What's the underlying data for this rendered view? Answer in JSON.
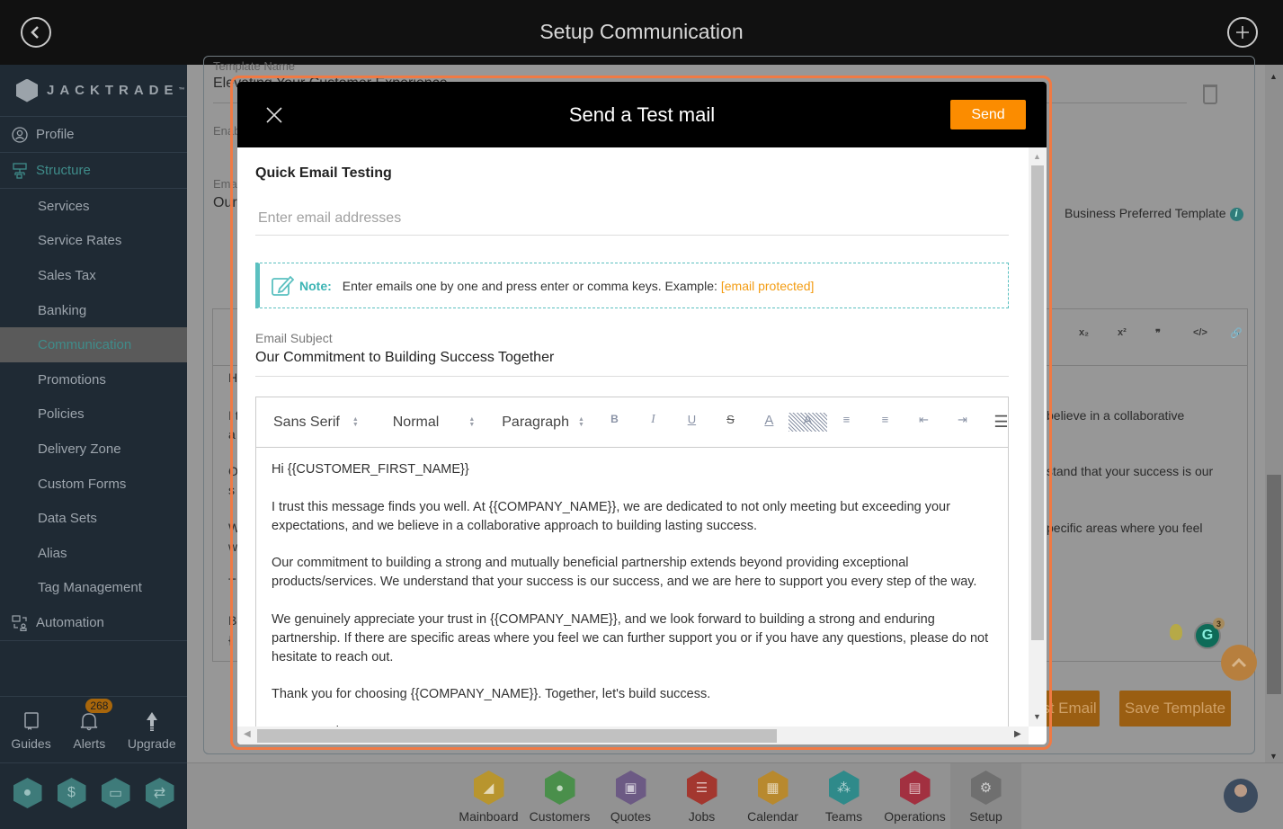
{
  "header": {
    "title": "Setup Communication",
    "back_icon": "back-arrow-icon",
    "add_icon": "plus-circle-icon"
  },
  "sidebar": {
    "logo_text": "JACKTRADE",
    "logo_tm": "™",
    "items": [
      {
        "label": "Profile",
        "type": "top",
        "icon": "user-circle-icon"
      },
      {
        "label": "Structure",
        "type": "section",
        "icon": "sitemap-icon"
      },
      {
        "label": "Services",
        "type": "sub"
      },
      {
        "label": "Service Rates",
        "type": "sub"
      },
      {
        "label": "Sales Tax",
        "type": "sub"
      },
      {
        "label": "Banking",
        "type": "sub"
      },
      {
        "label": "Communication",
        "type": "sub",
        "active": true
      },
      {
        "label": "Promotions",
        "type": "sub"
      },
      {
        "label": "Policies",
        "type": "sub"
      },
      {
        "label": "Delivery Zone",
        "type": "sub"
      },
      {
        "label": "Custom Forms",
        "type": "sub"
      },
      {
        "label": "Data Sets",
        "type": "sub"
      },
      {
        "label": "Alias",
        "type": "sub"
      },
      {
        "label": "Tag Management",
        "type": "sub"
      },
      {
        "label": "Automation",
        "type": "top",
        "icon": "automation-icon"
      }
    ],
    "tools": [
      {
        "label": "Guides",
        "icon": "book-icon"
      },
      {
        "label": "Alerts",
        "icon": "bell-icon",
        "badge": "268"
      },
      {
        "label": "Upgrade",
        "icon": "arrow-up-icon"
      }
    ],
    "quick_icons": [
      "user-hex-icon",
      "dollar-hex-icon",
      "money-hex-icon",
      "workflow-hex-icon"
    ]
  },
  "background": {
    "template_name_label": "Template Name",
    "template_name_value": "Elevating Your Customer Experience",
    "enable_label": "Enab",
    "email_label": "Ema",
    "email_value": "Our",
    "business_preferred": "Business Preferred Template",
    "toolbar_fragments": [
      "¶",
      "x₂",
      "x²",
      "❞",
      "</>",
      "🔗"
    ],
    "body_fragments": [
      {
        "left": "H",
        "right": ""
      },
      {
        "left": "I t",
        "right": "believe in a collaborative"
      },
      {
        "left": "a",
        "right": ""
      },
      {
        "left": "O",
        "right": "stand that your success is our"
      },
      {
        "left": "s",
        "right": ""
      },
      {
        "left": "W",
        "right": "pecific areas where you feel"
      },
      {
        "left": "w",
        "right": ""
      },
      {
        "left": "T",
        "right": ""
      },
      {
        "left": "B",
        "right": ""
      },
      {
        "left": "{",
        "right": ""
      }
    ],
    "test_email_button": "Test Email",
    "save_template_button": "Save Template",
    "grammarly_count": "3"
  },
  "dock": {
    "items": [
      {
        "label": "Mainboard",
        "color": "#b8952e",
        "icon": "mainboard-icon"
      },
      {
        "label": "Customers",
        "color": "#4a8f4b",
        "icon": "customers-icon"
      },
      {
        "label": "Quotes",
        "color": "#6c5a84",
        "icon": "quotes-icon"
      },
      {
        "label": "Jobs",
        "color": "#a3372f",
        "icon": "jobs-icon"
      },
      {
        "label": "Calendar",
        "color": "#b8892e",
        "icon": "calendar-icon"
      },
      {
        "label": "Teams",
        "color": "#2f8a8a",
        "icon": "teams-icon"
      },
      {
        "label": "Operations",
        "color": "#a23040",
        "icon": "operations-icon"
      },
      {
        "label": "Setup",
        "color": "#6f6f6f",
        "icon": "gear-icon",
        "active": true
      }
    ]
  },
  "modal": {
    "title": "Send a Test mail",
    "send_label": "Send",
    "section_title": "Quick Email Testing",
    "email_placeholder": "Enter email addresses",
    "email_value": "",
    "note_label": "Note:",
    "note_text": "Enter emails one by one and press enter or comma keys. Example:",
    "note_example": "[email protected]",
    "subject_label": "Email Subject",
    "subject_value": "Our Commitment to Building Success Together",
    "editor": {
      "font": "Sans Serif",
      "size": "Normal",
      "block": "Paragraph",
      "buttons": [
        {
          "name": "bold-button",
          "glyph": "B"
        },
        {
          "name": "italic-button",
          "glyph": "I"
        },
        {
          "name": "underline-button",
          "glyph": "U"
        },
        {
          "name": "strike-button",
          "glyph": "S"
        },
        {
          "name": "text-color-button",
          "glyph": "A"
        },
        {
          "name": "highlight-button",
          "glyph": "A"
        },
        {
          "name": "ordered-list-button",
          "glyph": "≡"
        },
        {
          "name": "bullet-list-button",
          "glyph": "≡"
        },
        {
          "name": "outdent-button",
          "glyph": "⇤"
        },
        {
          "name": "indent-button",
          "glyph": "⇥"
        },
        {
          "name": "align-button",
          "glyph": "☰"
        }
      ],
      "paragraphs": [
        "Hi {{CUSTOMER_FIRST_NAME}}",
        "I trust this message finds you well. At {{COMPANY_NAME}}, we are dedicated to not only meeting but exceeding your expectations, and we believe in a collaborative approach to building lasting success.",
        "Our commitment to building a strong and mutually beneficial partnership extends beyond providing exceptional products/services. We understand that your success is our success, and we are here to support you every step of the way.",
        "We genuinely appreciate your trust in {{COMPANY_NAME}}, and we look forward to building a strong and enduring partnership. If there are specific areas where you feel we can further support you or if you have any questions, please do not hesitate to reach out.",
        "Thank you for choosing {{COMPANY_NAME}}. Together, let's build success.",
        "Best regards,"
      ]
    }
  }
}
